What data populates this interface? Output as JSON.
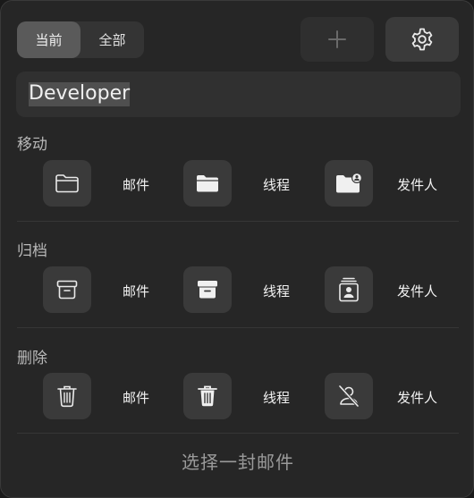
{
  "segment": {
    "current_label": "当前",
    "all_label": "全部"
  },
  "toolbar": {
    "add_icon": "plus-icon",
    "settings_icon": "gear-icon"
  },
  "search": {
    "value": "Developer"
  },
  "sections": {
    "move": {
      "title": "移动",
      "actions": [
        {
          "icon": "folder-outline-icon",
          "label": "邮件"
        },
        {
          "icon": "folder-filled-icon",
          "label": "线程"
        },
        {
          "icon": "folder-person-icon",
          "label": "发件人"
        }
      ]
    },
    "archive": {
      "title": "归档",
      "actions": [
        {
          "icon": "archive-outline-icon",
          "label": "邮件"
        },
        {
          "icon": "archive-filled-icon",
          "label": "线程"
        },
        {
          "icon": "archive-person-icon",
          "label": "发件人"
        }
      ]
    },
    "delete": {
      "title": "删除",
      "actions": [
        {
          "icon": "trash-outline-icon",
          "label": "邮件"
        },
        {
          "icon": "trash-filled-icon",
          "label": "线程"
        },
        {
          "icon": "person-slash-icon",
          "label": "发件人"
        }
      ]
    }
  },
  "footer": {
    "text": "选择一封邮件"
  },
  "colors": {
    "panel": "#262626",
    "button": "#3a3a3a",
    "active_segment": "#5a5a5a"
  }
}
